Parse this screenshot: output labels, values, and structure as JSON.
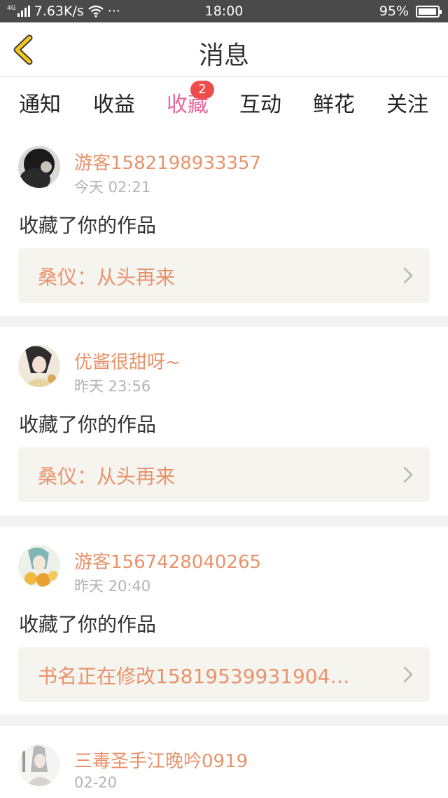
{
  "status_bar": {
    "network": "4G",
    "speed": "7.63K/s",
    "more": "···",
    "time": "18:00",
    "battery": "95%"
  },
  "header": {
    "title": "消息",
    "back_icon": "chevron-left-icon"
  },
  "tabs": [
    {
      "label": "通知",
      "active": false
    },
    {
      "label": "收益",
      "active": false
    },
    {
      "label": "收藏",
      "active": true,
      "badge": "2"
    },
    {
      "label": "互动",
      "active": false
    },
    {
      "label": "鲜花",
      "active": false
    },
    {
      "label": "关注",
      "active": false
    }
  ],
  "colors": {
    "accent": "#e8679a",
    "username": "#e9926a",
    "badge": "#ef4c4c",
    "back_arrow": "#f5c518"
  },
  "messages": [
    {
      "username": "游客1582198933357",
      "time": "今天 02:21",
      "action": "收藏了你的作品",
      "work_title": "桑仪：从头再来"
    },
    {
      "username": "优酱很甜呀~",
      "time": "昨天 23:56",
      "action": "收藏了你的作品",
      "work_title": "桑仪：从头再来"
    },
    {
      "username": "游客1567428040265",
      "time": "昨天 20:40",
      "action": "收藏了你的作品",
      "work_title": "书名正在修改15819539931904…"
    },
    {
      "username": "三毒圣手江晚吟0919",
      "time": "02-20"
    }
  ]
}
